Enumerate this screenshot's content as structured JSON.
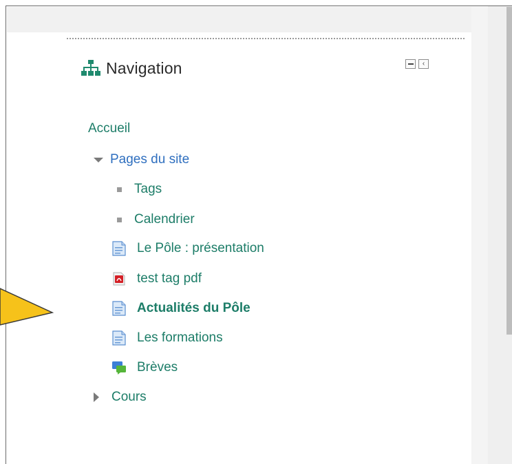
{
  "block": {
    "title": "Navigation",
    "icon": "sitemap-icon",
    "controls": {
      "collapse_icon": "minus-icon",
      "dock_icon": "chevron-left-icon"
    }
  },
  "nav": {
    "home": "Accueil",
    "site_pages": "Pages du site",
    "site_children": [
      {
        "label": "Tags",
        "icon": "bullet-icon"
      },
      {
        "label": "Calendrier",
        "icon": "bullet-icon"
      }
    ],
    "pages": [
      {
        "label": "Le Pôle : présentation",
        "icon": "page-icon"
      },
      {
        "label": "test tag pdf",
        "icon": "pdf-icon"
      },
      {
        "label": "Actualités du Pôle",
        "icon": "page-icon",
        "active": true
      },
      {
        "label": "Les formations",
        "icon": "page-icon"
      },
      {
        "label": "Brèves",
        "icon": "forum-icon"
      }
    ],
    "courses": "Cours"
  },
  "colors": {
    "link_green": "#1d7d68",
    "link_blue": "#2f6fbf",
    "callout_arrow_fill": "#f6c21a",
    "callout_arrow_stroke": "#3a3a3a",
    "scroll_thumb": "#bdbdbd"
  },
  "annotation": {
    "callout_icon": "callout-arrow",
    "points_to": "Actualités du Pôle"
  }
}
